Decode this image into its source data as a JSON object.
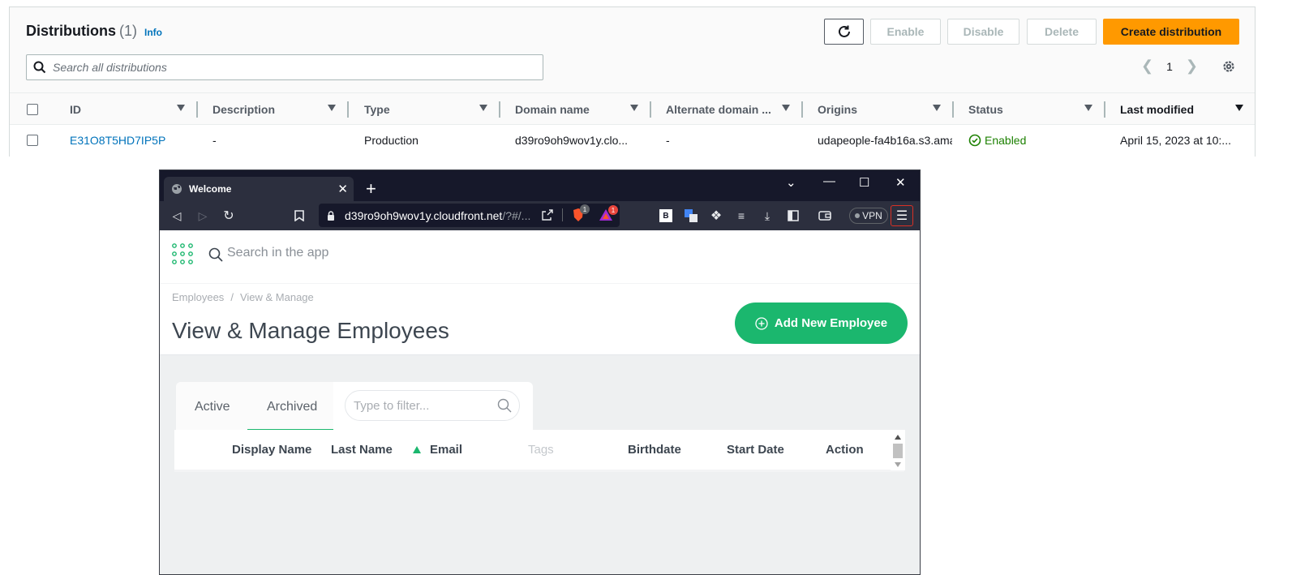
{
  "aws": {
    "title": "Distributions",
    "count": "(1)",
    "info_link": "Info",
    "buttons": {
      "enable": "Enable",
      "disable": "Disable",
      "delete": "Delete",
      "create": "Create distribution"
    },
    "search_placeholder": "Search all distributions",
    "page_number": "1",
    "columns": [
      "ID",
      "Description",
      "Type",
      "Domain name",
      "Alternate domain ...",
      "Origins",
      "Status",
      "Last modified"
    ],
    "row": {
      "id": "E31O8T5HD7IP5P",
      "description": "-",
      "type": "Production",
      "domain_name": "d39ro9oh9wov1y.clo...",
      "alternate_domain": "-",
      "origins": "udapeople-fa4b16a.s3.ama",
      "status": "Enabled",
      "last_modified": "April 15, 2023 at 10:..."
    },
    "colors": {
      "primary": "#ff9900",
      "link": "#0073bb",
      "success": "#1d8102"
    }
  },
  "browser": {
    "tab_title": "Welcome",
    "url_host": "d39ro9oh9wov1y.cloudfront.net",
    "url_rest": "/?#/...",
    "brave_badge": "1",
    "rewards_badge": "1",
    "ext_b_label": "B",
    "vpn_label": "VPN"
  },
  "app": {
    "search_placeholder": "Search in the app",
    "breadcrumb": {
      "parent": "Employees",
      "separator": "/",
      "current": "View & Manage"
    },
    "page_title": "View & Manage Employees",
    "add_button": "Add New Employee",
    "tabs": {
      "active": "Active",
      "archived": "Archived"
    },
    "filter_placeholder": "Type to filter...",
    "columns": {
      "display_name": "Display Name",
      "last_name": "Last Name",
      "email": "Email",
      "tags": "Tags",
      "birthdate": "Birthdate",
      "start_date": "Start Date",
      "action": "Action"
    },
    "colors": {
      "accent": "#1bb76e"
    }
  }
}
